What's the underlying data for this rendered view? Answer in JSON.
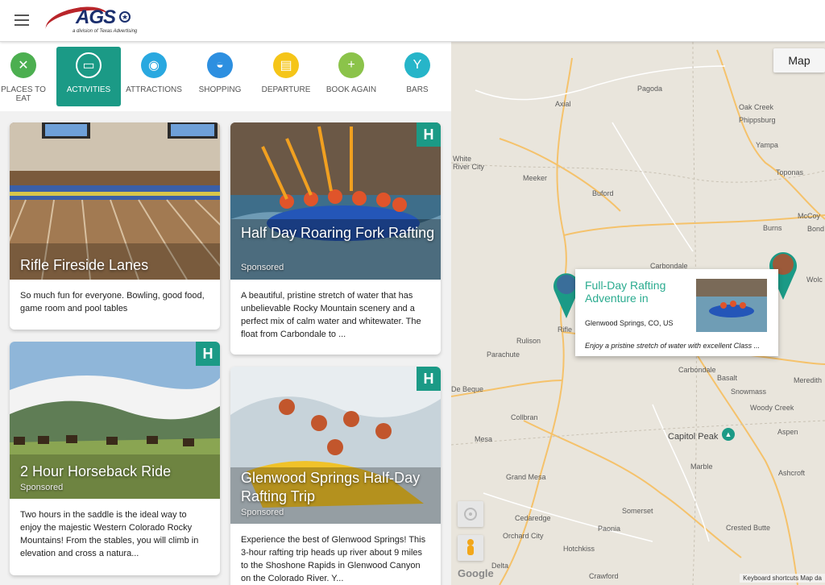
{
  "header": {
    "menu_icon": "hamburger-menu-icon",
    "logo_text": "AGS",
    "logo_tagline": "a division of Texas Advertising"
  },
  "categories": [
    {
      "label": "PLACES TO EAT",
      "icon": "fork-knife-icon",
      "color": "#4caf50"
    },
    {
      "label": "ACTIVITIES",
      "icon": "ticket-icon",
      "color": "#1b9a86",
      "active": true
    },
    {
      "label": "ATTRACTIONS",
      "icon": "camera-icon",
      "color": "#29a8e0"
    },
    {
      "label": "SHOPPING",
      "icon": "basket-icon",
      "color": "#2d8fe0"
    },
    {
      "label": "DEPARTURE",
      "icon": "clipboard-icon",
      "color": "#f5c518"
    },
    {
      "label": "BOOK AGAIN",
      "icon": "calendar-plus-icon",
      "color": "#8bc34a"
    },
    {
      "label": "BARS",
      "icon": "cocktail-icon",
      "color": "#26b5c9"
    }
  ],
  "cards": [
    {
      "title": "Rifle Fireside Lanes",
      "sponsored": "",
      "description": "So much fun for everyone. Bowling, good food, game room and pool tables"
    },
    {
      "title": "Half Day Roaring Fork Rafting",
      "sponsored": "Sponsored",
      "description": "A beautiful, pristine stretch of water that has unbelievable Rocky Mountain scenery and a perfect mix of calm water and whitewater. The float from Carbondale to ..."
    },
    {
      "title": "2 Hour Horseback Ride",
      "sponsored": "Sponsored",
      "description": "Two hours in the saddle is the ideal way to enjoy the majestic Western Colorado Rocky Mountains! From the stables, you will climb in elevation and cross a natura..."
    },
    {
      "title": "Glenwood Springs Half-Day Rafting Trip",
      "sponsored": "Sponsored",
      "description": "Experience the best of Glenwood Springs! This 3-hour rafting trip heads up river about 9 miles to the Shoshone Rapids in Glenwood Canyon on the Colorado River. Y..."
    }
  ],
  "map": {
    "type_button": "Map",
    "popup": {
      "title": "Full-Day Rafting Adventure in",
      "location": "Glenwood Springs, CO, US",
      "description": "Enjoy a pristine stretch of water with excellent Class ..."
    },
    "towns": [
      "Pagoda",
      "Axial",
      "Oak Creek",
      "Phippsburg",
      "Yampa",
      "White River City",
      "Meeker",
      "Buford",
      "Toponas",
      "McCoy",
      "Burns",
      "Bond",
      "Carbondale",
      "Wolc",
      "Rifle",
      "Rulison",
      "Parachute",
      "Carbondale",
      "Basalt",
      "Meredith",
      "De Beque",
      "Snowmass",
      "Woody Creek",
      "Collbran",
      "Mesa",
      "Capitol Peak",
      "Aspen",
      "Marble",
      "Ashcroft",
      "Grand Mesa",
      "Cedaredge",
      "Somerset",
      "Paonia",
      "Crested Butte",
      "Orchard City",
      "Hotchkiss",
      "Delta",
      "Crawford"
    ],
    "google": "Google",
    "footer": "Keyboard shortcuts   Map da"
  }
}
